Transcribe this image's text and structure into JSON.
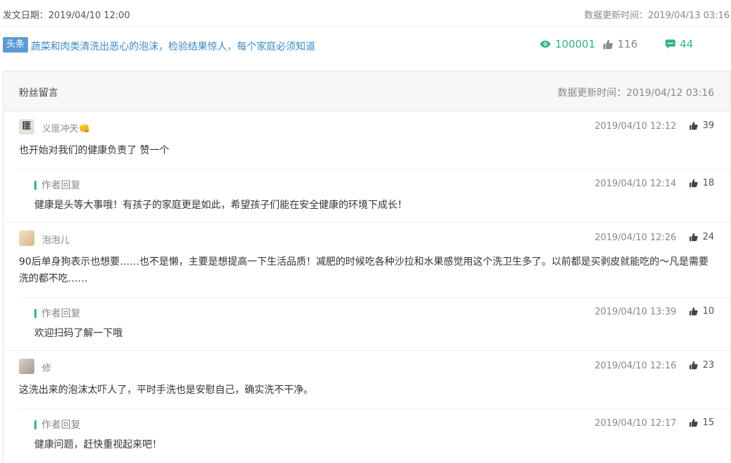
{
  "meta": {
    "publish_date": "发文日期：2019/04/10 12:00",
    "updated": "数据更新时间：2019/04/13 03:16"
  },
  "article": {
    "tag": "头条",
    "title": "蔬菜和肉类清洗出恶心的泡沫，检验结果惊人，每个家庭必须知道",
    "views": "100001",
    "likes": "116",
    "comments": "44"
  },
  "panel": {
    "title": "粉丝留言",
    "updated": "数据更新时间：2019/04/12 03:16"
  },
  "comments": [
    {
      "user": "义匪冲天👊",
      "avatar_text": "匪",
      "time": "2019/04/10 12:12",
      "likes": "39",
      "text": "也开始对我们的健康负责了 赞一个",
      "reply": {
        "label": "作者回复",
        "time": "2019/04/10 12:14",
        "likes": "18",
        "text": "健康是头等大事哦！有孩子的家庭更是如此，希望孩子们能在安全健康的环境下成长！"
      }
    },
    {
      "user": "泡泡儿",
      "avatar_text": "",
      "time": "2019/04/10 12:26",
      "likes": "24",
      "text": "90后单身狗表示也想要……也不是懒，主要是想提高一下生活品质！减肥的时候吃各种沙拉和水果感觉用这个洗卫生多了。以前都是买剥皮就能吃的～凡是需要洗的都不吃……",
      "reply": {
        "label": "作者回复",
        "time": "2019/04/10 13:39",
        "likes": "10",
        "text": "欢迎扫码了解一下哦"
      }
    },
    {
      "user": "修",
      "avatar_text": "",
      "time": "2019/04/10 12:16",
      "likes": "23",
      "text": "这洗出来的泡沫太吓人了，平时手洗也是安慰自己，确实洗不干净。",
      "reply": {
        "label": "作者回复",
        "time": "2019/04/10 12:17",
        "likes": "15",
        "text": "健康问题，赶快重视起来吧！"
      }
    }
  ],
  "colors": {
    "accent_green": "#2fb67c",
    "link_blue": "#3a8ac7",
    "tag_blue": "#5b9bd5"
  }
}
